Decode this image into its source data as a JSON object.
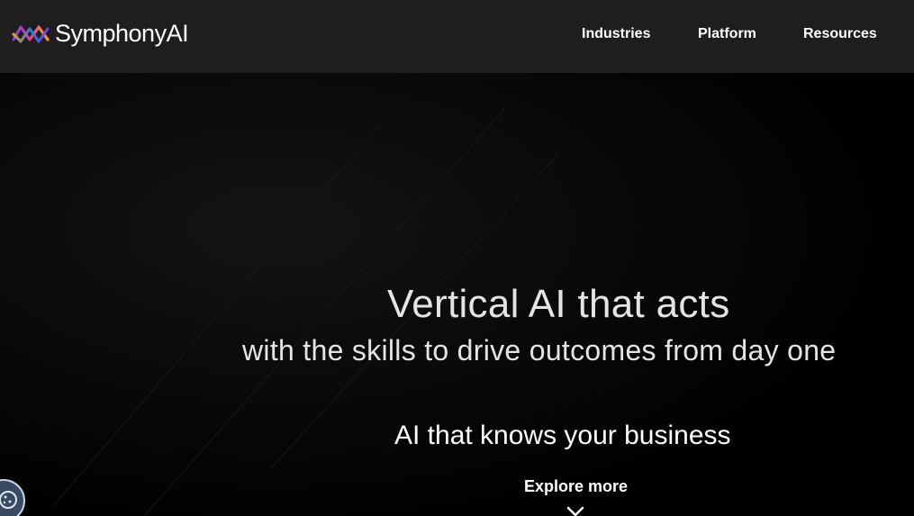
{
  "brand": {
    "name": "SymphonyAI",
    "logo_colors": [
      "#7b3fe4",
      "#e83e8c",
      "#f5a623",
      "#2f80ed"
    ]
  },
  "nav": {
    "items": [
      {
        "label": "Industries"
      },
      {
        "label": "Platform"
      },
      {
        "label": "Resources"
      }
    ]
  },
  "hero": {
    "title": "Vertical AI that acts",
    "subtitle": "with the skills to drive outcomes from day one",
    "tagline": "AI that knows your business",
    "explore_label": "Explore more",
    "explore_icon": "chevron-down-icon"
  },
  "cookie_button": {
    "icon": "cookie-icon"
  },
  "colors": {
    "header_bg": "#1e1e1e",
    "hero_bg": "#000000",
    "text_primary": "#ffffff",
    "text_hero": "#e4e4e4"
  }
}
